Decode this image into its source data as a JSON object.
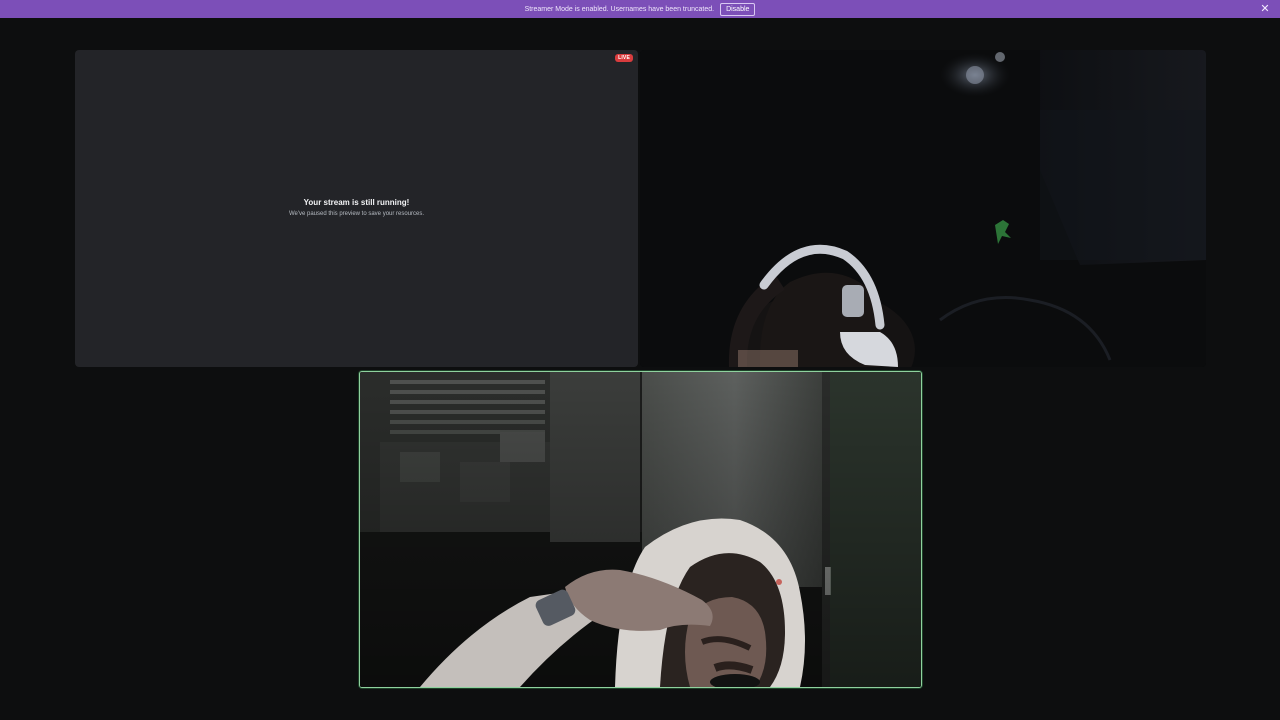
{
  "banner": {
    "message": "Streamer Mode is enabled. Usernames have been truncated.",
    "disable_label": "Disable",
    "close_glyph": "✕",
    "background_color": "#7c4fb8"
  },
  "stream_tile": {
    "live_badge": "LIVE",
    "title": "Your stream is still running!",
    "subtitle": "We've paused this preview to save your resources."
  },
  "camera_tile_main": {
    "border_color": "#8fd19e"
  }
}
